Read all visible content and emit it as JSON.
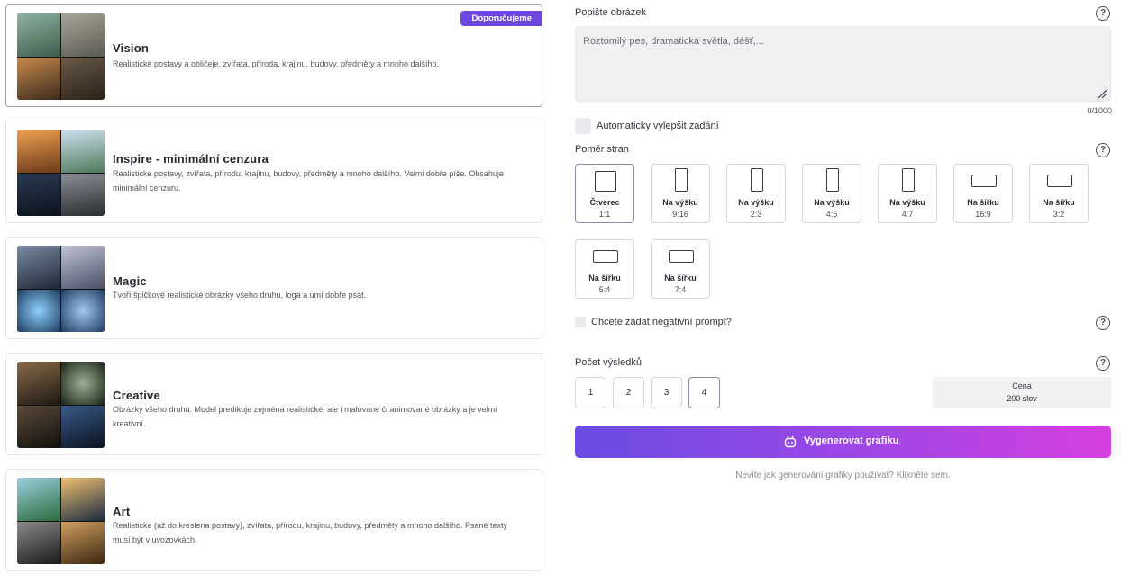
{
  "models": [
    {
      "title": "Vision",
      "description": "Realistické postavy a obličeje, zvířata, příroda, krajinu, budovy, předměty a mnoho dalšího.",
      "badge": "Doporučujeme",
      "thumb_colors": [
        "#4f6b5a",
        "#7c7a6e",
        "#6b4a2e",
        "#4b3a2c"
      ]
    },
    {
      "title": "Inspire - minimální cenzura",
      "description": "Realistické postavy, zvířata, přírodu, krajinu, budovy, předměty a mnoho dalšího. Velmi dobře píše. Obsahuje minimální cenzuru.",
      "thumb_colors": [
        "#c26b2a",
        "#6f8fb8",
        "#1e2a3a",
        "#4a4e56"
      ]
    },
    {
      "title": "Magic",
      "description": "Tvoří špičkové realistické obrázky všeho druhu, loga a umí dobře psát.",
      "thumb_colors": [
        "#384a5c",
        "#6a6f84",
        "#2a4f6e",
        "#3b5f86"
      ]
    },
    {
      "title": "Creative",
      "description": "Obrázky všeho druhu. Model predikuje zejména realistické, ale i malované či animované obrázky a je velmi kreativní.",
      "thumb_colors": [
        "#3a3128",
        "#2c3526",
        "#2a2620",
        "#1c2a40"
      ]
    },
    {
      "title": "Art",
      "description": "Realistické (až do kreslena postavy), zvířata, přírodu, krajinu, budovy, předměty a mnoho dalšího. Psané texty musí být v uvozovkách.",
      "thumb_colors": [
        "#3f7a8e",
        "#1f3b52",
        "#3a3a3a",
        "#7a5a30"
      ]
    }
  ],
  "form": {
    "prompt_label": "Popište obrázek",
    "prompt_placeholder": "Roztomilý pes, dramatická světla, déšť,...",
    "prompt_value": "",
    "counter": "0/1000",
    "auto_improve_label": "Automaticky vylepšit zadání",
    "ratio_label": "Poměr stran",
    "ratios": [
      {
        "name": "Čtverec",
        "value": "1:1",
        "selected": true,
        "icon": "square-icon"
      },
      {
        "name": "Na výšku",
        "value": "9:16",
        "icon": "portrait-icon"
      },
      {
        "name": "Na výšku",
        "value": "2:3",
        "icon": "portrait-icon"
      },
      {
        "name": "Na výšku",
        "value": "4:5",
        "icon": "portrait-icon"
      },
      {
        "name": "Na výšku",
        "value": "4:7",
        "icon": "portrait-icon"
      },
      {
        "name": "Na šířku",
        "value": "16:9",
        "icon": "landscape-icon"
      },
      {
        "name": "Na šířku",
        "value": "3:2",
        "icon": "landscape-icon"
      },
      {
        "name": "Na šířku",
        "value": "5:4",
        "icon": "landscape-icon"
      },
      {
        "name": "Na šířku",
        "value": "7:4",
        "icon": "landscape-icon"
      }
    ],
    "negative_prompt_label": "Chcete zadat negativní prompt?",
    "results_label": "Počet výsledků",
    "result_counts": [
      "1",
      "2",
      "3",
      "4"
    ],
    "selected_count": "4",
    "price_label": "Cena",
    "price_value": "200 slov",
    "generate_label": "Vygenerovat grafiku",
    "help_link": "Nevíte jak generování grafiky používat? Klikněte sem.",
    "help_glyph": "?"
  },
  "colors": {
    "accent": "#6f47de",
    "gradient_start": "#6a4ce4",
    "gradient_end": "#d63fe0"
  }
}
